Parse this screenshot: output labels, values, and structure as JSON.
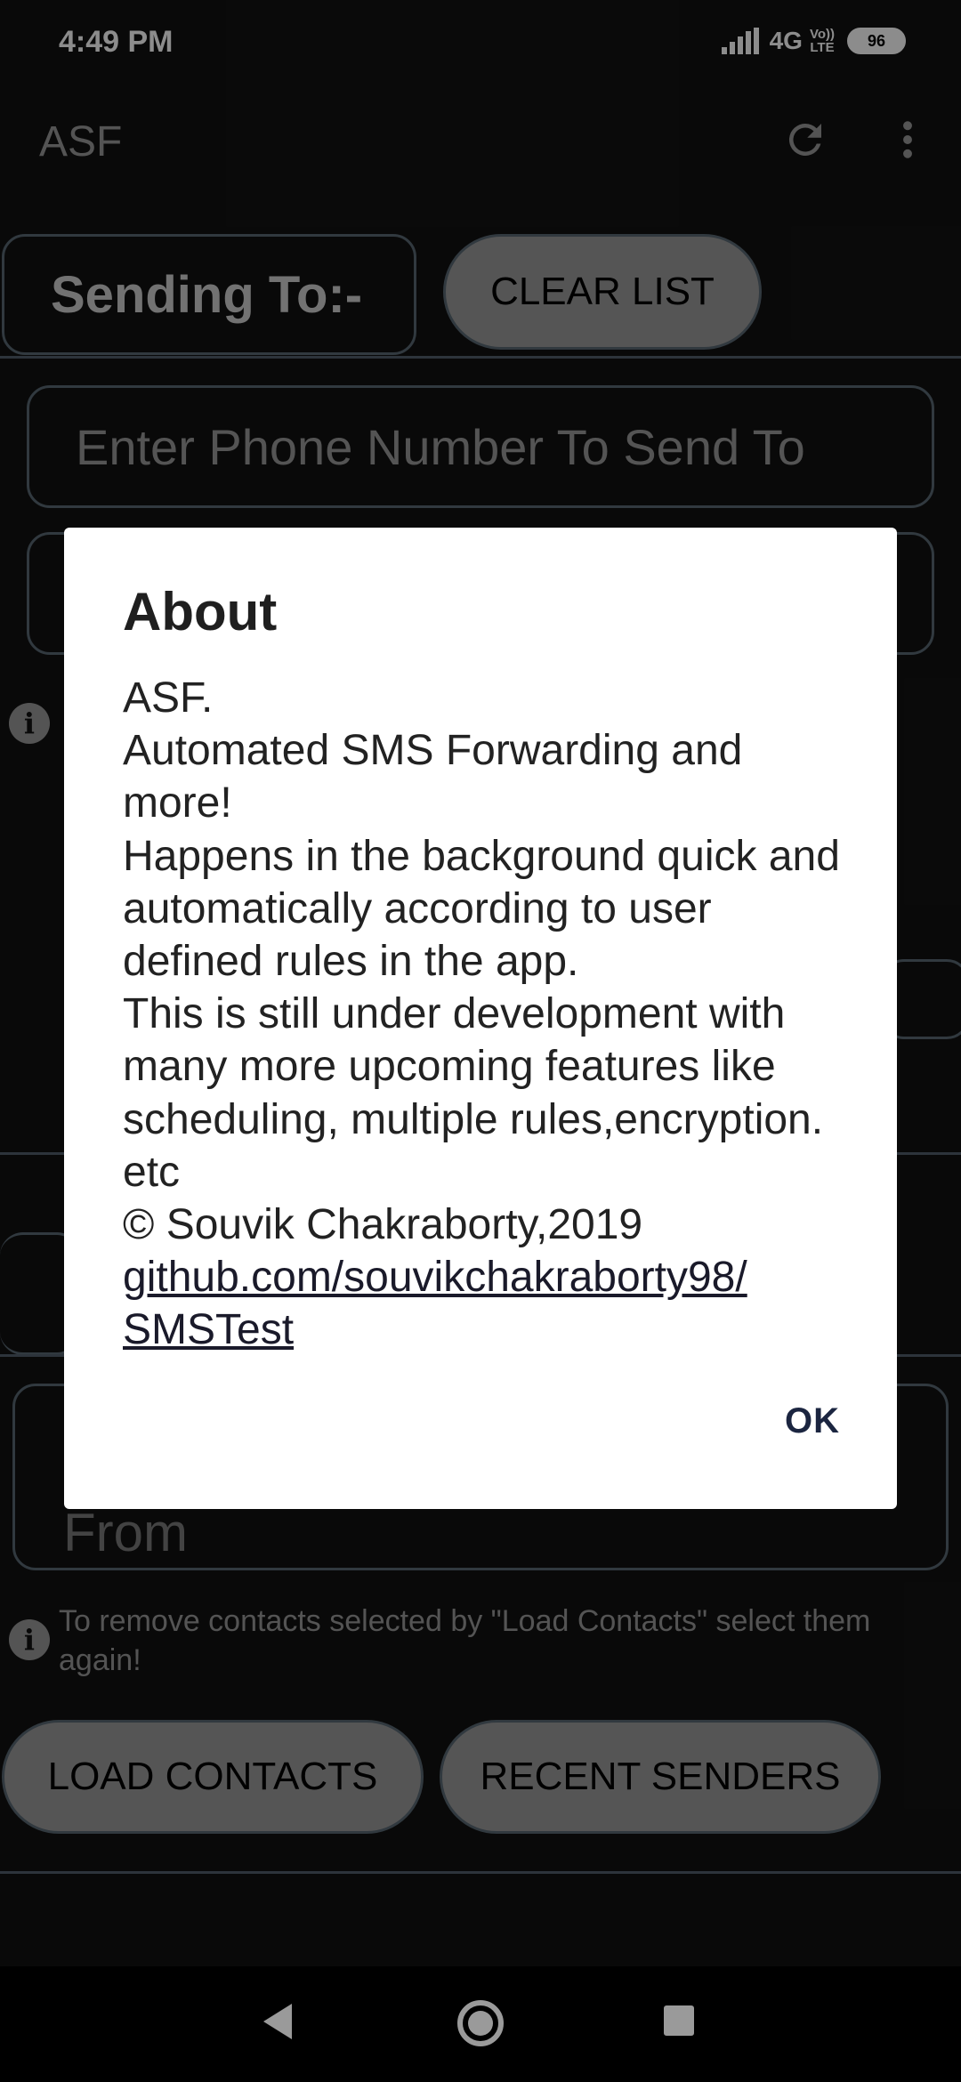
{
  "status_bar": {
    "time": "4:49 PM",
    "network": "4G",
    "volte_line1": "Vo))",
    "volte_line2": "LTE",
    "battery": "96"
  },
  "app_bar": {
    "title": "ASF",
    "icons": [
      "refresh-icon",
      "more-vert-icon"
    ]
  },
  "main": {
    "sending_to_label": "Sending To:-",
    "clear_list_label": "CLEAR LIST",
    "phone_input_placeholder": "Enter Phone Number To Send To",
    "from_field_label": "From",
    "hint_text": "To remove contacts selected by \"Load Contacts\" select them again!",
    "load_contacts_label": "LOAD CONTACTS",
    "recent_senders_label": "RECENT SENDERS"
  },
  "dialog": {
    "title": "About",
    "lines": [
      "ASF.",
      "Automated SMS Forwarding and more!",
      "Happens in the background quick and automatically according to user defined rules in the app.",
      "This is still under development with many more upcoming features like scheduling, multiple rules,encryption. etc",
      "© Souvik Chakraborty,2019"
    ],
    "link_line1": "github.com/souvikchakraborty98/",
    "link_line2": "SMSTest",
    "ok_label": "OK"
  },
  "nav_bar": {
    "icons": [
      "back-icon",
      "home-icon",
      "recents-icon"
    ]
  },
  "colors": {
    "background": "#121212",
    "dialog_bg": "#ffffff",
    "button_bg": "#9c9c9c",
    "outline": "#5a6874"
  }
}
